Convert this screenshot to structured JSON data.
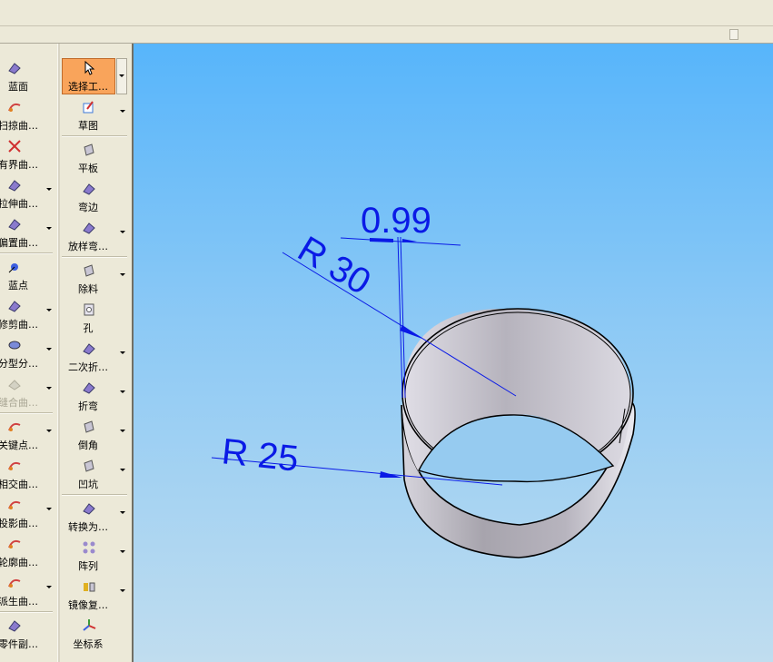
{
  "left_toolbar": {
    "col1": [
      {
        "label": "蓝面",
        "icon": "blue-surface-icon",
        "group_end": false
      },
      {
        "label": "扫掠曲…",
        "icon": "sweep-surface-icon",
        "group_end": false
      },
      {
        "label": "有界曲…",
        "icon": "bounded-surface-icon",
        "group_end": false
      },
      {
        "label": "拉伸曲…",
        "icon": "extrude-surface-icon",
        "group_end": false,
        "dropdown": true
      },
      {
        "label": "偏置曲…",
        "icon": "offset-surface-icon",
        "group_end": true,
        "dropdown": true
      },
      {
        "label": "蓝点",
        "icon": "blue-point-icon",
        "group_end": false
      },
      {
        "label": "修剪曲…",
        "icon": "trim-surface-icon",
        "group_end": false,
        "dropdown": true
      },
      {
        "label": "分型分…",
        "icon": "parting-icon",
        "group_end": false,
        "dropdown": true
      },
      {
        "label": "缝合曲…",
        "icon": "stitch-surface-icon",
        "group_end": true,
        "dropdown": true,
        "disabled": true
      },
      {
        "label": "关键点…",
        "icon": "keypoint-curve-icon",
        "group_end": false,
        "dropdown": true
      },
      {
        "label": "相交曲…",
        "icon": "intersect-curve-icon",
        "group_end": false
      },
      {
        "label": "投影曲…",
        "icon": "project-curve-icon",
        "group_end": false,
        "dropdown": true
      },
      {
        "label": "轮廓曲…",
        "icon": "contour-curve-icon",
        "group_end": false
      },
      {
        "label": "派生曲…",
        "icon": "derived-curve-icon",
        "group_end": true,
        "dropdown": true
      },
      {
        "label": "零件副…",
        "icon": "part-copy-icon",
        "group_end": false
      }
    ],
    "col2": [
      {
        "label": "选择工…",
        "icon": "select-cursor-icon",
        "selected": true
      },
      {
        "label": "草图",
        "icon": "sketch-icon",
        "dropdown": true,
        "group_end": true
      },
      {
        "label": "平板",
        "icon": "tab-plate-icon"
      },
      {
        "label": "弯边",
        "icon": "flange-icon"
      },
      {
        "label": "放样弯…",
        "icon": "lofted-flange-icon",
        "dropdown": true,
        "group_end": true
      },
      {
        "label": "除料",
        "icon": "cutout-icon",
        "dropdown": true
      },
      {
        "label": "孔",
        "icon": "hole-icon"
      },
      {
        "label": "二次折…",
        "icon": "jog-icon",
        "dropdown": true
      },
      {
        "label": "折弯",
        "icon": "bend-icon",
        "dropdown": true
      },
      {
        "label": "倒角",
        "icon": "chamfer-icon",
        "dropdown": true
      },
      {
        "label": "凹坑",
        "icon": "dimple-icon",
        "dropdown": true,
        "group_end": true
      },
      {
        "label": "转换为…",
        "icon": "convert-icon",
        "dropdown": true
      },
      {
        "label": "阵列",
        "icon": "pattern-icon",
        "dropdown": true
      },
      {
        "label": "镜像复…",
        "icon": "mirror-copy-icon",
        "dropdown": true
      },
      {
        "label": "坐标系",
        "icon": "coordinate-system-icon"
      }
    ]
  },
  "viewport": {
    "dimensions": {
      "thickness": "0.99",
      "outer_radius": "R 30",
      "inner_radius": "R 25"
    },
    "colors": {
      "dimension": "#0a1ae6",
      "cylinder_outer": "#b9b6c0",
      "cylinder_inner": "#c8c5cf",
      "edge": "#000000"
    }
  }
}
